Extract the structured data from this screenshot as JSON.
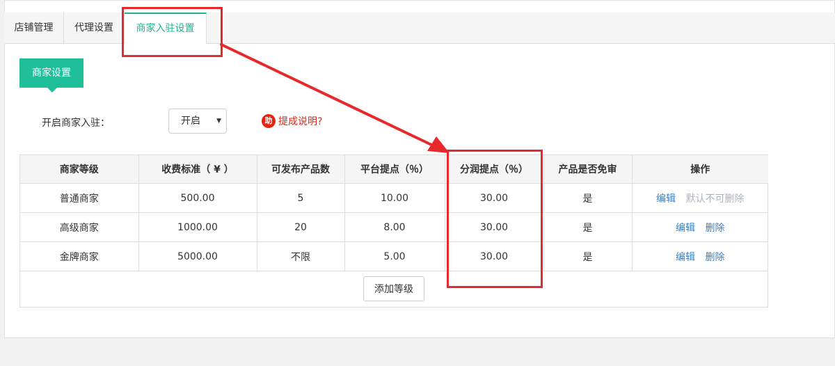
{
  "tabs": [
    {
      "label": "店铺管理",
      "active": false
    },
    {
      "label": "代理设置",
      "active": false
    },
    {
      "label": "商家入驻设置",
      "active": true
    }
  ],
  "section_title": "商家设置",
  "merchant_entry": {
    "label": "开启商家入驻：",
    "selected": "开启",
    "help_icon_text": "助",
    "help_link": "提成说明?"
  },
  "table": {
    "headers": [
      "商家等级",
      "收费标准（ ¥ ）",
      "可发布产品数",
      "平台提点（％）",
      "分润提点（％）",
      "产品是否免审",
      "操作"
    ],
    "rows": [
      {
        "level": "普通商家",
        "fee": "500.00",
        "products": "5",
        "platform_pct": "10.00",
        "share_pct": "30.00",
        "exempt": "是",
        "edit": "编辑",
        "delete": "",
        "note": "默认不可删除"
      },
      {
        "level": "高级商家",
        "fee": "1000.00",
        "products": "20",
        "platform_pct": "8.00",
        "share_pct": "30.00",
        "exempt": "是",
        "edit": "编辑",
        "delete": "删除",
        "note": ""
      },
      {
        "level": "金牌商家",
        "fee": "5000.00",
        "products": "不限",
        "platform_pct": "5.00",
        "share_pct": "30.00",
        "exempt": "是",
        "edit": "编辑",
        "delete": "删除",
        "note": ""
      }
    ]
  },
  "add_level_label": "添加等级",
  "colors": {
    "accent": "#1fbf9a",
    "link": "#3d7fc0",
    "annotation": "#e8292b",
    "help": "#e8240f"
  }
}
